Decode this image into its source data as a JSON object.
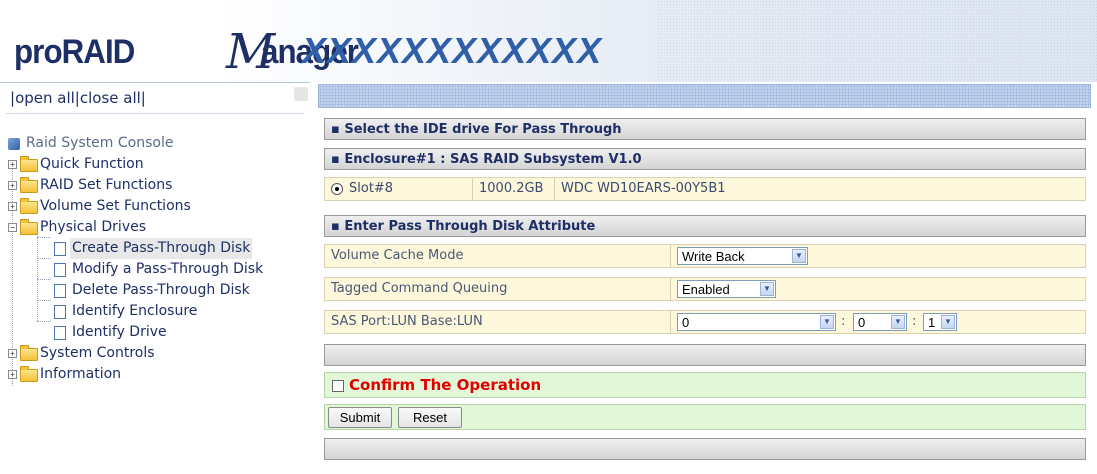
{
  "header": {
    "logo_pro": "proRAID",
    "logo_m": "M",
    "logo_anager": "anager",
    "brand": "XXXXXXXXXXXX"
  },
  "nav": {
    "open_all": "open all",
    "separator": "|",
    "close_all": "close all",
    "root": "Raid System Console",
    "items": [
      {
        "label": "Quick Function"
      },
      {
        "label": "RAID Set Functions"
      },
      {
        "label": "Volume Set Functions"
      },
      {
        "label": "Physical Drives"
      },
      {
        "label": "Create Pass-Through Disk"
      },
      {
        "label": "Modify a Pass-Through Disk"
      },
      {
        "label": "Delete Pass-Through Disk"
      },
      {
        "label": "Identify Enclosure"
      },
      {
        "label": "Identify Drive"
      },
      {
        "label": "System Controls"
      },
      {
        "label": "Information"
      }
    ]
  },
  "main": {
    "select_title": "Select the IDE drive For Pass Through",
    "enclosure_title": "Enclosure#1 : SAS RAID Subsystem V1.0",
    "slot": {
      "slot": "Slot#8",
      "capacity": "1000.2GB",
      "model": "WDC WD10EARS-00Y5B1"
    },
    "attr_title": "Enter Pass Through Disk Attribute",
    "attributes": [
      {
        "label": "Volume Cache Mode",
        "value": "Write Back"
      },
      {
        "label": "Tagged Command Queuing",
        "value": "Enabled"
      },
      {
        "label": "SAS Port:LUN Base:LUN",
        "port": "0",
        "lun_base": "0",
        "lun": "1"
      }
    ],
    "colon": ":",
    "confirm": "Confirm The Operation",
    "submit": "Submit",
    "reset": "Reset"
  },
  "colors": {
    "accent": "#1e2f66",
    "confirm": "#e00000",
    "row_bg": "#fdf7dc",
    "green_bg": "#e2f7d8"
  }
}
